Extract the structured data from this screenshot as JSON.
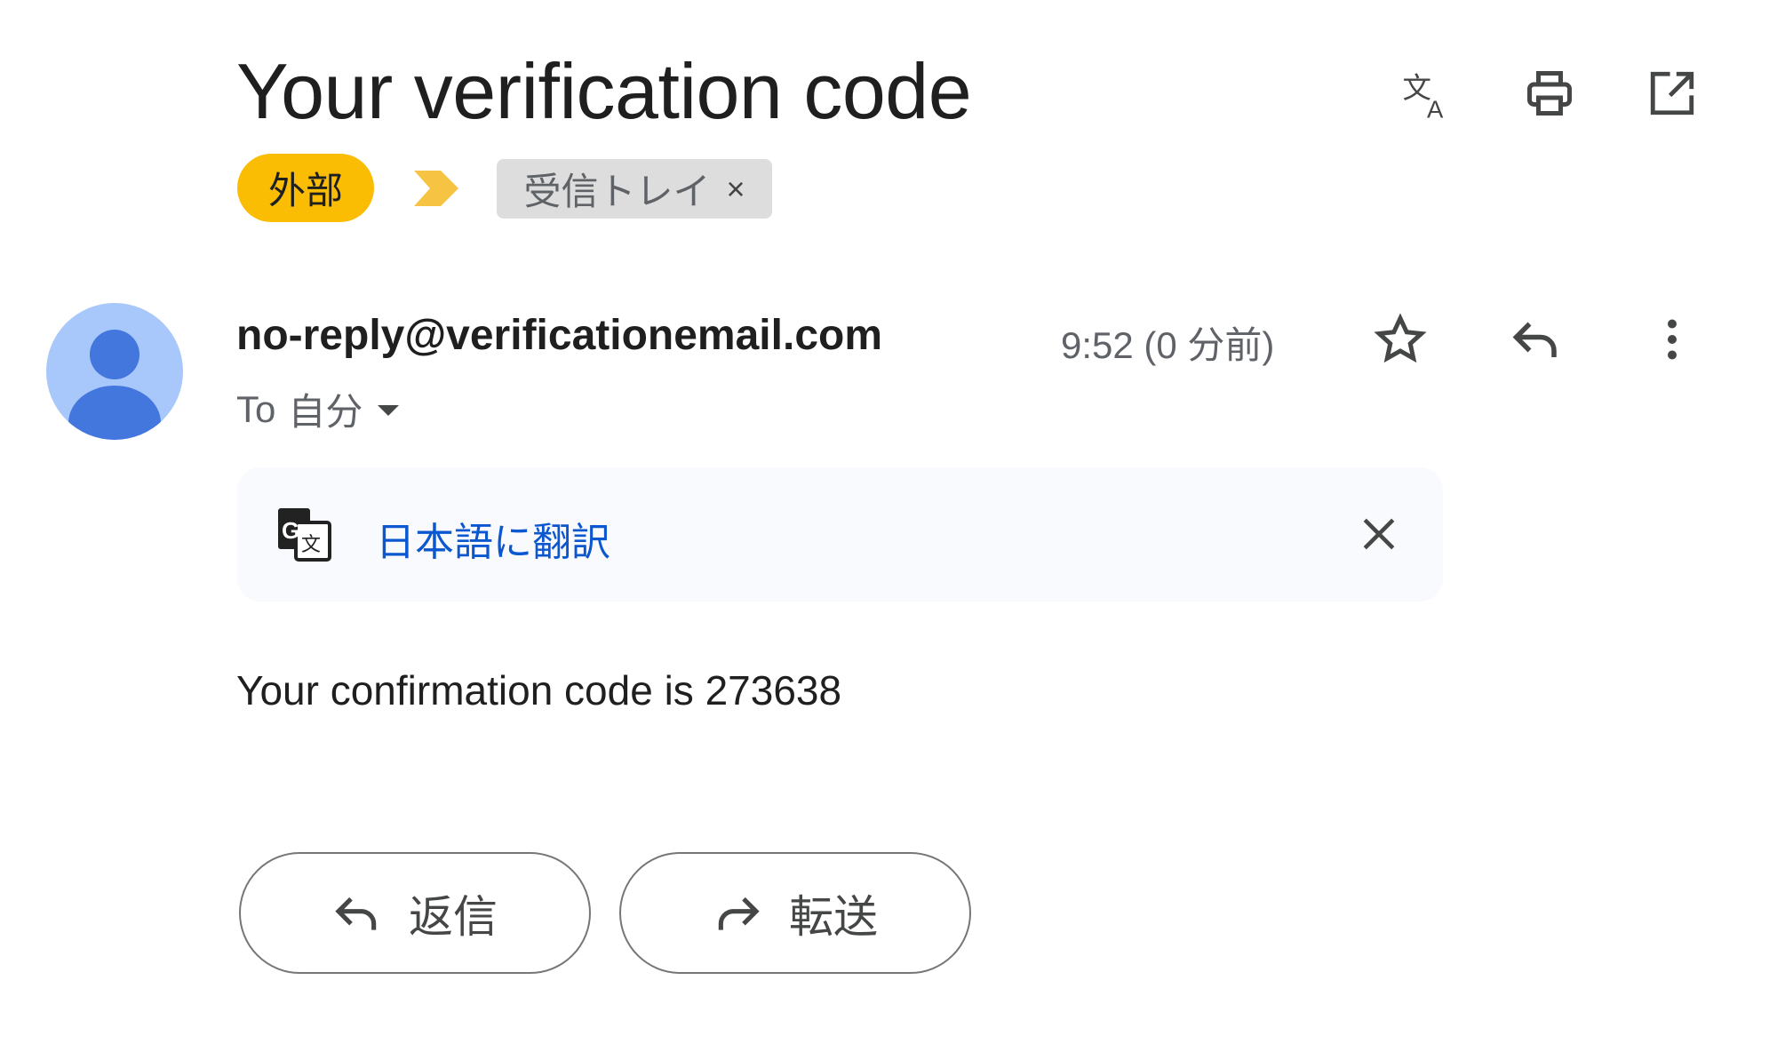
{
  "subject": "Your verification code",
  "header_icons": [
    "translate-icon",
    "print-icon",
    "open-in-new-window-icon"
  ],
  "labels": {
    "external": "外部",
    "importance_marker": "important-marker-icon",
    "inbox": "受信トレイ",
    "inbox_remove": "×"
  },
  "colors": {
    "external_chip": "#fbbc04",
    "importance": "#f6c343",
    "link": "#0b57d0",
    "avatar_bg": "#a8c7fa",
    "avatar_fg": "#4477dd"
  },
  "message": {
    "sender": "no-reply@verificationemail.com",
    "time": "9:52 (0 分前)",
    "to_prefix": "To",
    "to": "自分",
    "body": "Your confirmation code is 273638"
  },
  "translate_bar": {
    "link": "日本語に翻訳"
  },
  "actions": {
    "reply": "返信",
    "forward": "転送"
  }
}
